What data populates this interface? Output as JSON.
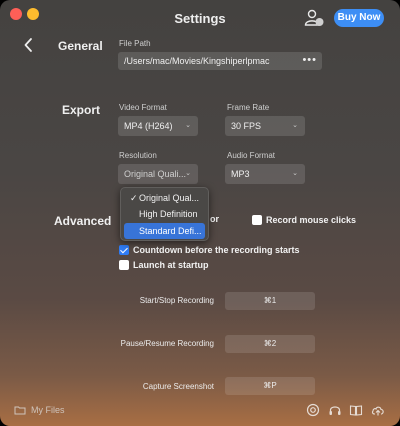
{
  "window": {
    "title": "Settings"
  },
  "header": {
    "buy_label": "Buy Now"
  },
  "sections": {
    "general": "General",
    "export": "Export",
    "advanced": "Advanced"
  },
  "general": {
    "file_path_label": "File Path",
    "file_path_value": "/Users/mac/Movies/Kingshiperlpmac"
  },
  "export": {
    "video_format_label": "Video Format",
    "video_format_value": "MP4 (H264)",
    "frame_rate_label": "Frame Rate",
    "frame_rate_value": "30 FPS",
    "resolution_label": "Resolution",
    "resolution_value": "Original Quali...",
    "audio_format_label": "Audio Format",
    "audio_format_value": "MP3"
  },
  "resolution_menu": {
    "options": [
      "Original Qual...",
      "High Definition",
      "Standard Defi..."
    ],
    "checked_index": 0,
    "highlighted_index": 2
  },
  "advanced": {
    "partial_label": "or",
    "record_mouse_clicks": {
      "label": "Record mouse clicks",
      "checked": false
    },
    "countdown": {
      "label": "Countdown before the recording starts",
      "checked": true
    },
    "launch_at_startup": {
      "label": "Launch at startup",
      "checked": false
    }
  },
  "shortcuts": [
    {
      "label": "Start/Stop Recording",
      "key": "⌘1"
    },
    {
      "label": "Pause/Resume Recording",
      "key": "⌘2"
    },
    {
      "label": "Capture Screenshot",
      "key": "⌘P"
    }
  ],
  "footer": {
    "my_files_label": "My Files"
  },
  "icons": {
    "back": "chevron-left-icon",
    "avatar": "user-avatar-icon",
    "more": "more-dots-icon",
    "folder": "folder-icon",
    "record": "record-icon",
    "support": "headset-icon",
    "guide": "book-icon",
    "upload": "cloud-upload-icon",
    "check": "checkmark-icon",
    "dropdown": "chevron-down-icon"
  },
  "colors": {
    "accent": "#3d8ef5",
    "highlight": "#3874d8",
    "checkbox_checked": "#2f7cf6",
    "close": "#fe5f57",
    "minimize": "#febc2e"
  }
}
